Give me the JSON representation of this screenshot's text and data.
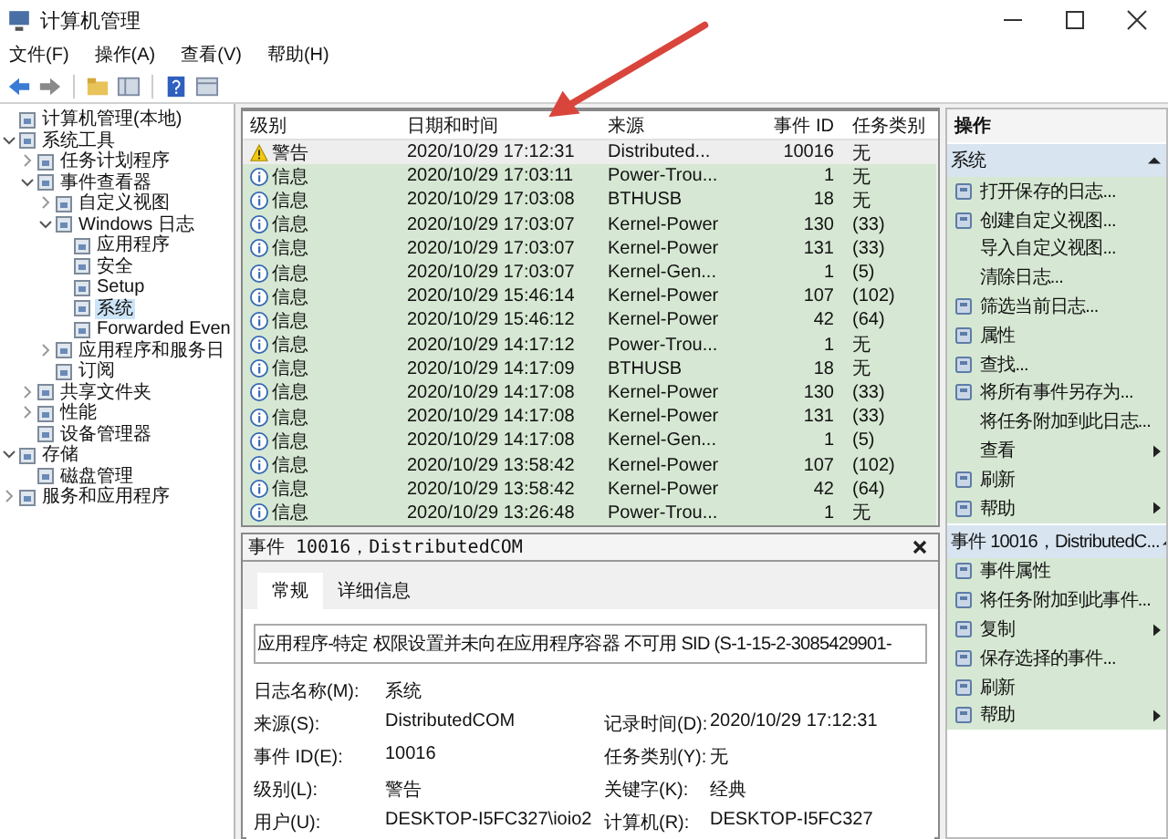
{
  "window": {
    "title": "计算机管理"
  },
  "menu": [
    "文件(F)",
    "操作(A)",
    "查看(V)",
    "帮助(H)"
  ],
  "tree": [
    {
      "label": "计算机管理(本地)",
      "selected": false
    },
    {
      "label": "系统工具",
      "selected": false,
      "expanded": true,
      "children": [
        {
          "label": "任务计划程序",
          "selected": false,
          "expanded": false
        },
        {
          "label": "事件查看器",
          "selected": false,
          "expanded": true,
          "children": [
            {
              "label": "自定义视图",
              "selected": false,
              "expanded": false
            },
            {
              "label": "Windows 日志",
              "selected": false,
              "expanded": true,
              "children": [
                {
                  "label": "应用程序",
                  "selected": false
                },
                {
                  "label": "安全",
                  "selected": false
                },
                {
                  "label": "Setup",
                  "selected": false
                },
                {
                  "label": "系统",
                  "selected": true
                },
                {
                  "label": "Forwarded Even",
                  "selected": false
                }
              ]
            },
            {
              "label": "应用程序和服务日",
              "selected": false,
              "expanded": false
            },
            {
              "label": "订阅",
              "selected": false
            }
          ]
        },
        {
          "label": "共享文件夹",
          "selected": false,
          "expanded": false
        },
        {
          "label": "性能",
          "selected": false,
          "expanded": false
        },
        {
          "label": "设备管理器",
          "selected": false
        }
      ]
    },
    {
      "label": "存储",
      "selected": false,
      "expanded": true,
      "children": [
        {
          "label": "磁盘管理",
          "selected": false
        }
      ]
    },
    {
      "label": "服务和应用程序",
      "selected": false,
      "expanded": false
    }
  ],
  "events": {
    "columns": [
      "级别",
      "日期和时间",
      "来源",
      "事件 ID",
      "任务类别"
    ],
    "rows": [
      {
        "kind": "warning",
        "level": "警告",
        "time": "2020/10/29 17:12:31",
        "source": "Distributed...",
        "id": "10016",
        "category": "无",
        "selected": true
      },
      {
        "kind": "info",
        "level": "信息",
        "time": "2020/10/29 17:03:11",
        "source": "Power-Trou...",
        "id": "1",
        "category": "无",
        "selected": false
      },
      {
        "kind": "info",
        "level": "信息",
        "time": "2020/10/29 17:03:08",
        "source": "BTHUSB",
        "id": "18",
        "category": "无",
        "selected": false
      },
      {
        "kind": "info",
        "level": "信息",
        "time": "2020/10/29 17:03:07",
        "source": "Kernel-Power",
        "id": "130",
        "category": "(33)",
        "selected": false
      },
      {
        "kind": "info",
        "level": "信息",
        "time": "2020/10/29 17:03:07",
        "source": "Kernel-Power",
        "id": "131",
        "category": "(33)",
        "selected": false
      },
      {
        "kind": "info",
        "level": "信息",
        "time": "2020/10/29 17:03:07",
        "source": "Kernel-Gen...",
        "id": "1",
        "category": "(5)",
        "selected": false
      },
      {
        "kind": "info",
        "level": "信息",
        "time": "2020/10/29 15:46:14",
        "source": "Kernel-Power",
        "id": "107",
        "category": "(102)",
        "selected": false
      },
      {
        "kind": "info",
        "level": "信息",
        "time": "2020/10/29 15:46:12",
        "source": "Kernel-Power",
        "id": "42",
        "category": "(64)",
        "selected": false
      },
      {
        "kind": "info",
        "level": "信息",
        "time": "2020/10/29 14:17:12",
        "source": "Power-Trou...",
        "id": "1",
        "category": "无",
        "selected": false
      },
      {
        "kind": "info",
        "level": "信息",
        "time": "2020/10/29 14:17:09",
        "source": "BTHUSB",
        "id": "18",
        "category": "无",
        "selected": false
      },
      {
        "kind": "info",
        "level": "信息",
        "time": "2020/10/29 14:17:08",
        "source": "Kernel-Power",
        "id": "130",
        "category": "(33)",
        "selected": false
      },
      {
        "kind": "info",
        "level": "信息",
        "time": "2020/10/29 14:17:08",
        "source": "Kernel-Power",
        "id": "131",
        "category": "(33)",
        "selected": false
      },
      {
        "kind": "info",
        "level": "信息",
        "time": "2020/10/29 14:17:08",
        "source": "Kernel-Gen...",
        "id": "1",
        "category": "(5)",
        "selected": false
      },
      {
        "kind": "info",
        "level": "信息",
        "time": "2020/10/29 13:58:42",
        "source": "Kernel-Power",
        "id": "107",
        "category": "(102)",
        "selected": false
      },
      {
        "kind": "info",
        "level": "信息",
        "time": "2020/10/29 13:58:42",
        "source": "Kernel-Power",
        "id": "42",
        "category": "(64)",
        "selected": false
      },
      {
        "kind": "info",
        "level": "信息",
        "time": "2020/10/29 13:26:48",
        "source": "Power-Trou...",
        "id": "1",
        "category": "无",
        "selected": false
      }
    ]
  },
  "details": {
    "title": "事件 10016，DistributedCOM",
    "tabs": [
      {
        "label": "常规",
        "selected": true
      },
      {
        "label": "详细信息",
        "selected": false
      }
    ],
    "description": "应用程序-特定 权限设置并未向在应用程序容器 不可用 SID (S-1-15-2-3085429901-",
    "rows": [
      {
        "label": "日志名称(M):",
        "value": "系统"
      },
      {
        "label": "来源(S):",
        "value": "DistributedCOM",
        "label2": "记录时间(D):",
        "value2": "2020/10/29 17:12:31"
      },
      {
        "label": "事件 ID(E):",
        "value": "10016",
        "label2": "任务类别(Y):",
        "value2": "无"
      },
      {
        "label": "级别(L):",
        "value": "警告",
        "label2": "关键字(K):",
        "value2": "经典"
      },
      {
        "label": "用户(U):",
        "value": "DESKTOP-I5FC327\\ioio2",
        "label2": "计算机(R):",
        "value2": "DESKTOP-I5FC327"
      }
    ]
  },
  "actions": {
    "title": "操作",
    "sections": [
      {
        "title": "系统",
        "items": [
          {
            "label": "打开保存的日志...",
            "icon": true,
            "submenu": false
          },
          {
            "label": "创建自定义视图...",
            "icon": true,
            "submenu": false
          },
          {
            "label": "导入自定义视图...",
            "icon": false,
            "submenu": false
          },
          {
            "label": "清除日志...",
            "icon": false,
            "submenu": false
          },
          {
            "label": "筛选当前日志...",
            "icon": true,
            "submenu": false
          },
          {
            "label": "属性",
            "icon": true,
            "submenu": false
          },
          {
            "label": "查找...",
            "icon": true,
            "submenu": false
          },
          {
            "label": "将所有事件另存为...",
            "icon": true,
            "submenu": false
          },
          {
            "label": "将任务附加到此日志...",
            "icon": false,
            "submenu": false
          },
          {
            "label": "查看",
            "icon": false,
            "submenu": true
          },
          {
            "label": "刷新",
            "icon": true,
            "submenu": false
          },
          {
            "label": "帮助",
            "icon": true,
            "submenu": true
          }
        ]
      },
      {
        "title": "事件 10016，DistributedC...",
        "items": [
          {
            "label": "事件属性",
            "icon": true,
            "submenu": false
          },
          {
            "label": "将任务附加到此事件...",
            "icon": true,
            "submenu": false
          },
          {
            "label": "复制",
            "icon": true,
            "submenu": true
          },
          {
            "label": "保存选择的事件...",
            "icon": true,
            "submenu": false
          },
          {
            "label": "刷新",
            "icon": true,
            "submenu": false
          },
          {
            "label": "帮助",
            "icon": true,
            "submenu": true
          }
        ]
      }
    ]
  }
}
